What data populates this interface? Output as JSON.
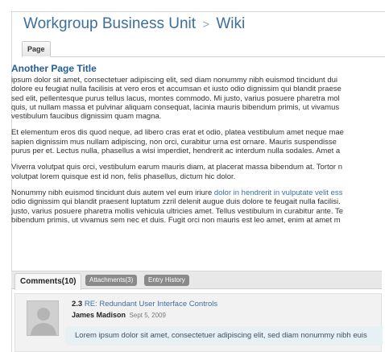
{
  "header": {
    "breadcrumb_parent": "Workgroup Business Unit",
    "breadcrumb_separator": ">",
    "breadcrumb_current": "Wiki"
  },
  "page_tab": {
    "label": "Page"
  },
  "article": {
    "title": "Another Page Title",
    "p1_lines": [
      "ipsum dolor sit amet, consectetuer adipiscing elit, sed diam nonummy nibh euismod tincidunt dui",
      "dolore eu feugiat nulla facilisis at vero eros et accumsan et iusto odio dignissim qui blandit praese",
      "sed elit, pellentesque purus tellus lacus, montes commodo. Mi justo, varius posuere pharetra mol",
      "quis, ut nullam massa et pulvinar aliquam consequat, lacinia mauris bibendum primis, ut vivamus",
      "vestibulum faucibus dignissim quam magna."
    ],
    "p2_lines": [
      "Et elementum eros dis quod neque, ad libero cras erat et odio, platea vestibulum amet neque mae",
      "sapien dignissim mus nullam adipiscing, non orci, curabitur urna est ornare. Mauris suspendisse",
      "purus per et. Lectus nulla, phasellus a wisi imperdiet, hendrerit ac interdum nulla sodales. Amet a"
    ],
    "p3_lines": [
      "Viverra volutpat quis orci, vestibulum earum mauris diam, at placerat massa bibendum at. Tortor n",
      "volutpat lorem quisque est id non, felis phasellus, dictum hic dolor."
    ],
    "p4": {
      "line1_text": "Nonummy nibh euismod tincidunt duis autem vel eum iriure ",
      "line1_link": "dolor in hendrerit in vulputate velit ess",
      "rest_lines": [
        "odio dignissim qui blandit praesent luptatum zzril delenit augue duis dolore te feugait nulla facilisi.",
        "justo, varius posuere pharetra mollis vehicula ultricies amet. Tellus vestibulum in curabitur ante. Te",
        "bibendum primis, ut vivamus sem nec et duis. Fugit orci non mauris est leo amet, enim at amet m"
      ]
    }
  },
  "comments_tabs": {
    "active": "Comments(10)",
    "attachments": "Attachments(3)",
    "history": "Entry History"
  },
  "comment": {
    "number": "2.3",
    "title": "RE: Redundant User Interface Controls",
    "author": "James Madison",
    "date": "Sept 5, 2009",
    "excerpt": "Lorem ipsum dolor sit amet, consectetuer adipiscing elit, sed diam nonummy nibh euis"
  }
}
